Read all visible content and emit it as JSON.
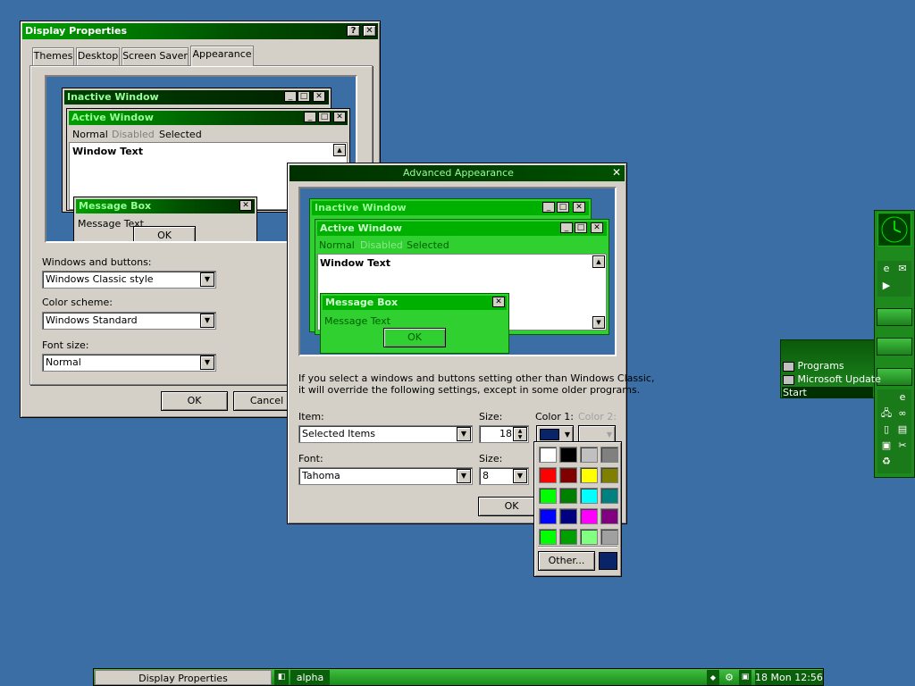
{
  "display_properties": {
    "title": "Display Properties",
    "help_btn": "?",
    "close_btn": "✕",
    "tabs": [
      "Themes",
      "Desktop",
      "Screen Saver",
      "Appearance"
    ],
    "preview": {
      "inactive_title": "Inactive Window",
      "active_title": "Active Window",
      "menu": [
        "Normal",
        "Disabled",
        "Selected"
      ],
      "window_text": "Window Text",
      "msgbox_title": "Message Box",
      "msgbox_text": "Message Text",
      "msgbox_ok": "OK"
    },
    "windows_buttons_label": "Windows and buttons:",
    "windows_buttons_value": "Windows Classic style",
    "color_scheme_label": "Color scheme:",
    "color_scheme_value": "Windows Standard",
    "font_size_label": "Font size:",
    "font_size_value": "Normal",
    "ok": "OK",
    "cancel": "Cancel"
  },
  "advanced": {
    "title": "Advanced Appearance",
    "close_btn": "✕",
    "preview": {
      "inactive_title": "Inactive Window",
      "active_title": "Active Window",
      "menu": [
        "Normal",
        "Disabled",
        "Selected"
      ],
      "window_text": "Window Text",
      "msgbox_title": "Message Box",
      "msgbox_text": "Message Text",
      "msgbox_ok": "OK"
    },
    "info_line1": "If you select a windows and buttons setting other than Windows Classic,",
    "info_line2": "it will override the following settings, except in some older programs.",
    "item_label": "Item:",
    "item_value": "Selected Items",
    "size_label": "Size:",
    "size_value": "18",
    "color1_label": "Color 1:",
    "color2_label": "Color 2:",
    "font_label": "Font:",
    "font_value": "Tahoma",
    "font_size_label": "Size:",
    "font_size_value": "8",
    "ok": "OK"
  },
  "color_picker": {
    "colors": [
      "#ffffff",
      "#000000",
      "#c0c0c0",
      "#808080",
      "#ff0000",
      "#800000",
      "#ffff00",
      "#808000",
      "#00ff00",
      "#008000",
      "#00ffff",
      "#008080",
      "#0000ff",
      "#000080",
      "#ff00ff",
      "#800080",
      "#00ff00",
      "#00a000",
      "#80ff80",
      "#a0a0a0"
    ],
    "selected_color": "#0a246a",
    "other_label": "Other..."
  },
  "start_menu": {
    "items": [
      "Programs",
      "Microsoft Update"
    ],
    "start_label": "Start"
  },
  "taskbar": {
    "task1": "Display Properties",
    "task2": "alpha",
    "clock": "18 Mon 12:56"
  },
  "colors": {
    "desktop": "#3a6ea5",
    "accent_green": "#00c000"
  }
}
